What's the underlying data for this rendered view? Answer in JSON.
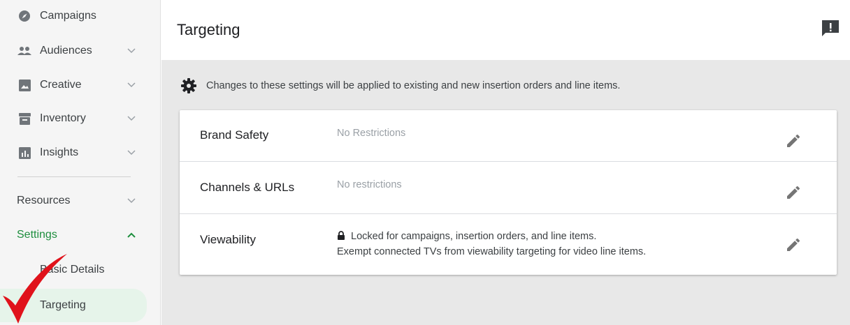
{
  "sidebar": {
    "items": [
      {
        "label": "Campaigns",
        "icon": "compass-icon"
      },
      {
        "label": "Audiences",
        "icon": "people-icon"
      },
      {
        "label": "Creative",
        "icon": "image-icon"
      },
      {
        "label": "Inventory",
        "icon": "inventory-icon"
      },
      {
        "label": "Insights",
        "icon": "insights-chart-icon"
      }
    ],
    "resources_label": "Resources",
    "settings_label": "Settings",
    "sub_items": [
      {
        "label": "Basic Details"
      },
      {
        "label": "Targeting"
      }
    ]
  },
  "header": {
    "title": "Targeting"
  },
  "notice": {
    "text": "Changes to these settings will be applied to existing and new insertion orders and line items."
  },
  "targeting_rows": [
    {
      "label": "Brand Safety",
      "value": "No Restrictions"
    },
    {
      "label": "Channels & URLs",
      "value": "No restrictions"
    },
    {
      "label": "Viewability",
      "line1": "Locked for campaigns, insertion orders, and line items.",
      "line2": "Exempt connected TVs from viewability targeting for video line items."
    }
  ],
  "colors": {
    "accent_green": "#1e8e3e",
    "active_bg": "#e6f4ea",
    "checkmark_red": "#e0121b"
  }
}
